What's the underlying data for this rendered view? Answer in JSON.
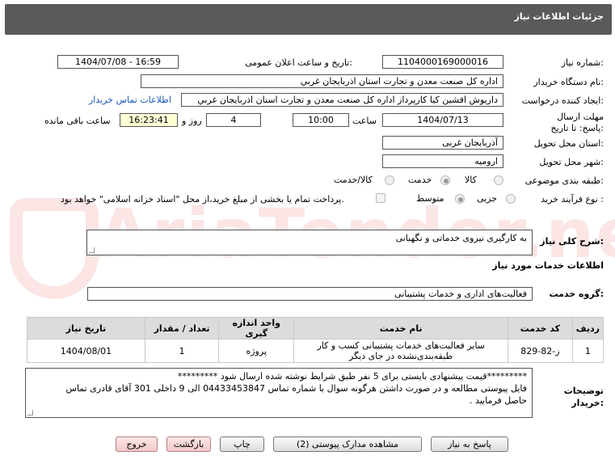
{
  "header": {
    "title": "جزئیات اطلاعات نیاز"
  },
  "form": {
    "need_number": {
      "label": "شماره نیاز:",
      "value": "1104000169000016"
    },
    "announce": {
      "label": "تاریخ و ساعت اعلان عمومی:",
      "value": "1404/07/08 - 16:59"
    },
    "buyer": {
      "label": "نام دستگاه خریدار:",
      "value": "اداره کل صنعت  معدن و تجارت استان اذربایجان غربي"
    },
    "creator": {
      "label": "ایجاد کننده درخواست:",
      "value": "داریوش افشین کیا کارپرداز اداره کل صنعت  معدن و تجارت استان اذربایجان غربي",
      "contact_link": "اطلاعات تماس خریدار"
    },
    "deadline": {
      "label": "مهلت ارسال پاسخ: تا تاریخ:",
      "date": "1404/07/13",
      "time_label": "ساعت",
      "time": "10:00",
      "days": "4",
      "days_label": "روز و",
      "remaining": "16:23:41",
      "remaining_label": "ساعت باقی مانده"
    },
    "province": {
      "label": "استان محل تحویل:",
      "value": "آذربایجان غربی"
    },
    "city": {
      "label": "شهر محل تحویل:",
      "value": "ارومیه"
    },
    "category": {
      "label": "طبقه بندی موضوعی:",
      "options": [
        "کالا",
        "خدمت",
        "کالا/خدمت"
      ],
      "selected": "خدمت"
    },
    "process": {
      "label": "نوع فرآیند خرید :",
      "options": [
        "جزیی",
        "متوسط"
      ],
      "selected": "متوسط",
      "payment_note": "پرداخت تمام یا بخشی از مبلغ خرید،از محل \"اسناد خزانه اسلامی\" خواهد بود."
    }
  },
  "summary": {
    "label": "شرح کلی نیاز:",
    "value": "به کارگیری نیروی خدماتی و نگهبانی"
  },
  "services_title": "اطلاعات خدمات مورد نیاز",
  "service_group": {
    "label": "گروه خدمت:",
    "value": "فعالیت‌های اداری و خدمات پشتیبانی"
  },
  "table": {
    "headers": [
      "ردیف",
      "کد خدمت",
      "نام خدمت",
      "واحد اندازه گیری",
      "تعداد / مقدار",
      "تاریخ نیاز"
    ],
    "rows": [
      {
        "index": "1",
        "code": "ز-82-829",
        "name": "سایر فعالیت‌های خدمات پشتیبانی کسب و کار طبقه‌بندی‌نشده در جای دیگر",
        "unit": "پروژه",
        "qty": "1",
        "date": "1404/08/01"
      }
    ]
  },
  "notes": {
    "label": "توضیحات خریدار:",
    "line1": "*********قیمت پیشنهادی بایستی برای 5 نفر طبق شرایط نوشته شده ارسال شود *********",
    "line2": "فایل پیوستی مطالعه و در صورت داشتن هرگونه سوال با شماره تماس 04433453847 الی 9 داخلی 301 آقای قادری تماس",
    "line3": "حاصل فرمایید ."
  },
  "buttons": {
    "respond": "پاسخ به نیاز",
    "view_docs": "مشاهده مدارک پیوستی (2)",
    "print": "چاپ",
    "back": "بازگشت",
    "exit": "خروج"
  },
  "watermark": "AriaTender.net"
}
